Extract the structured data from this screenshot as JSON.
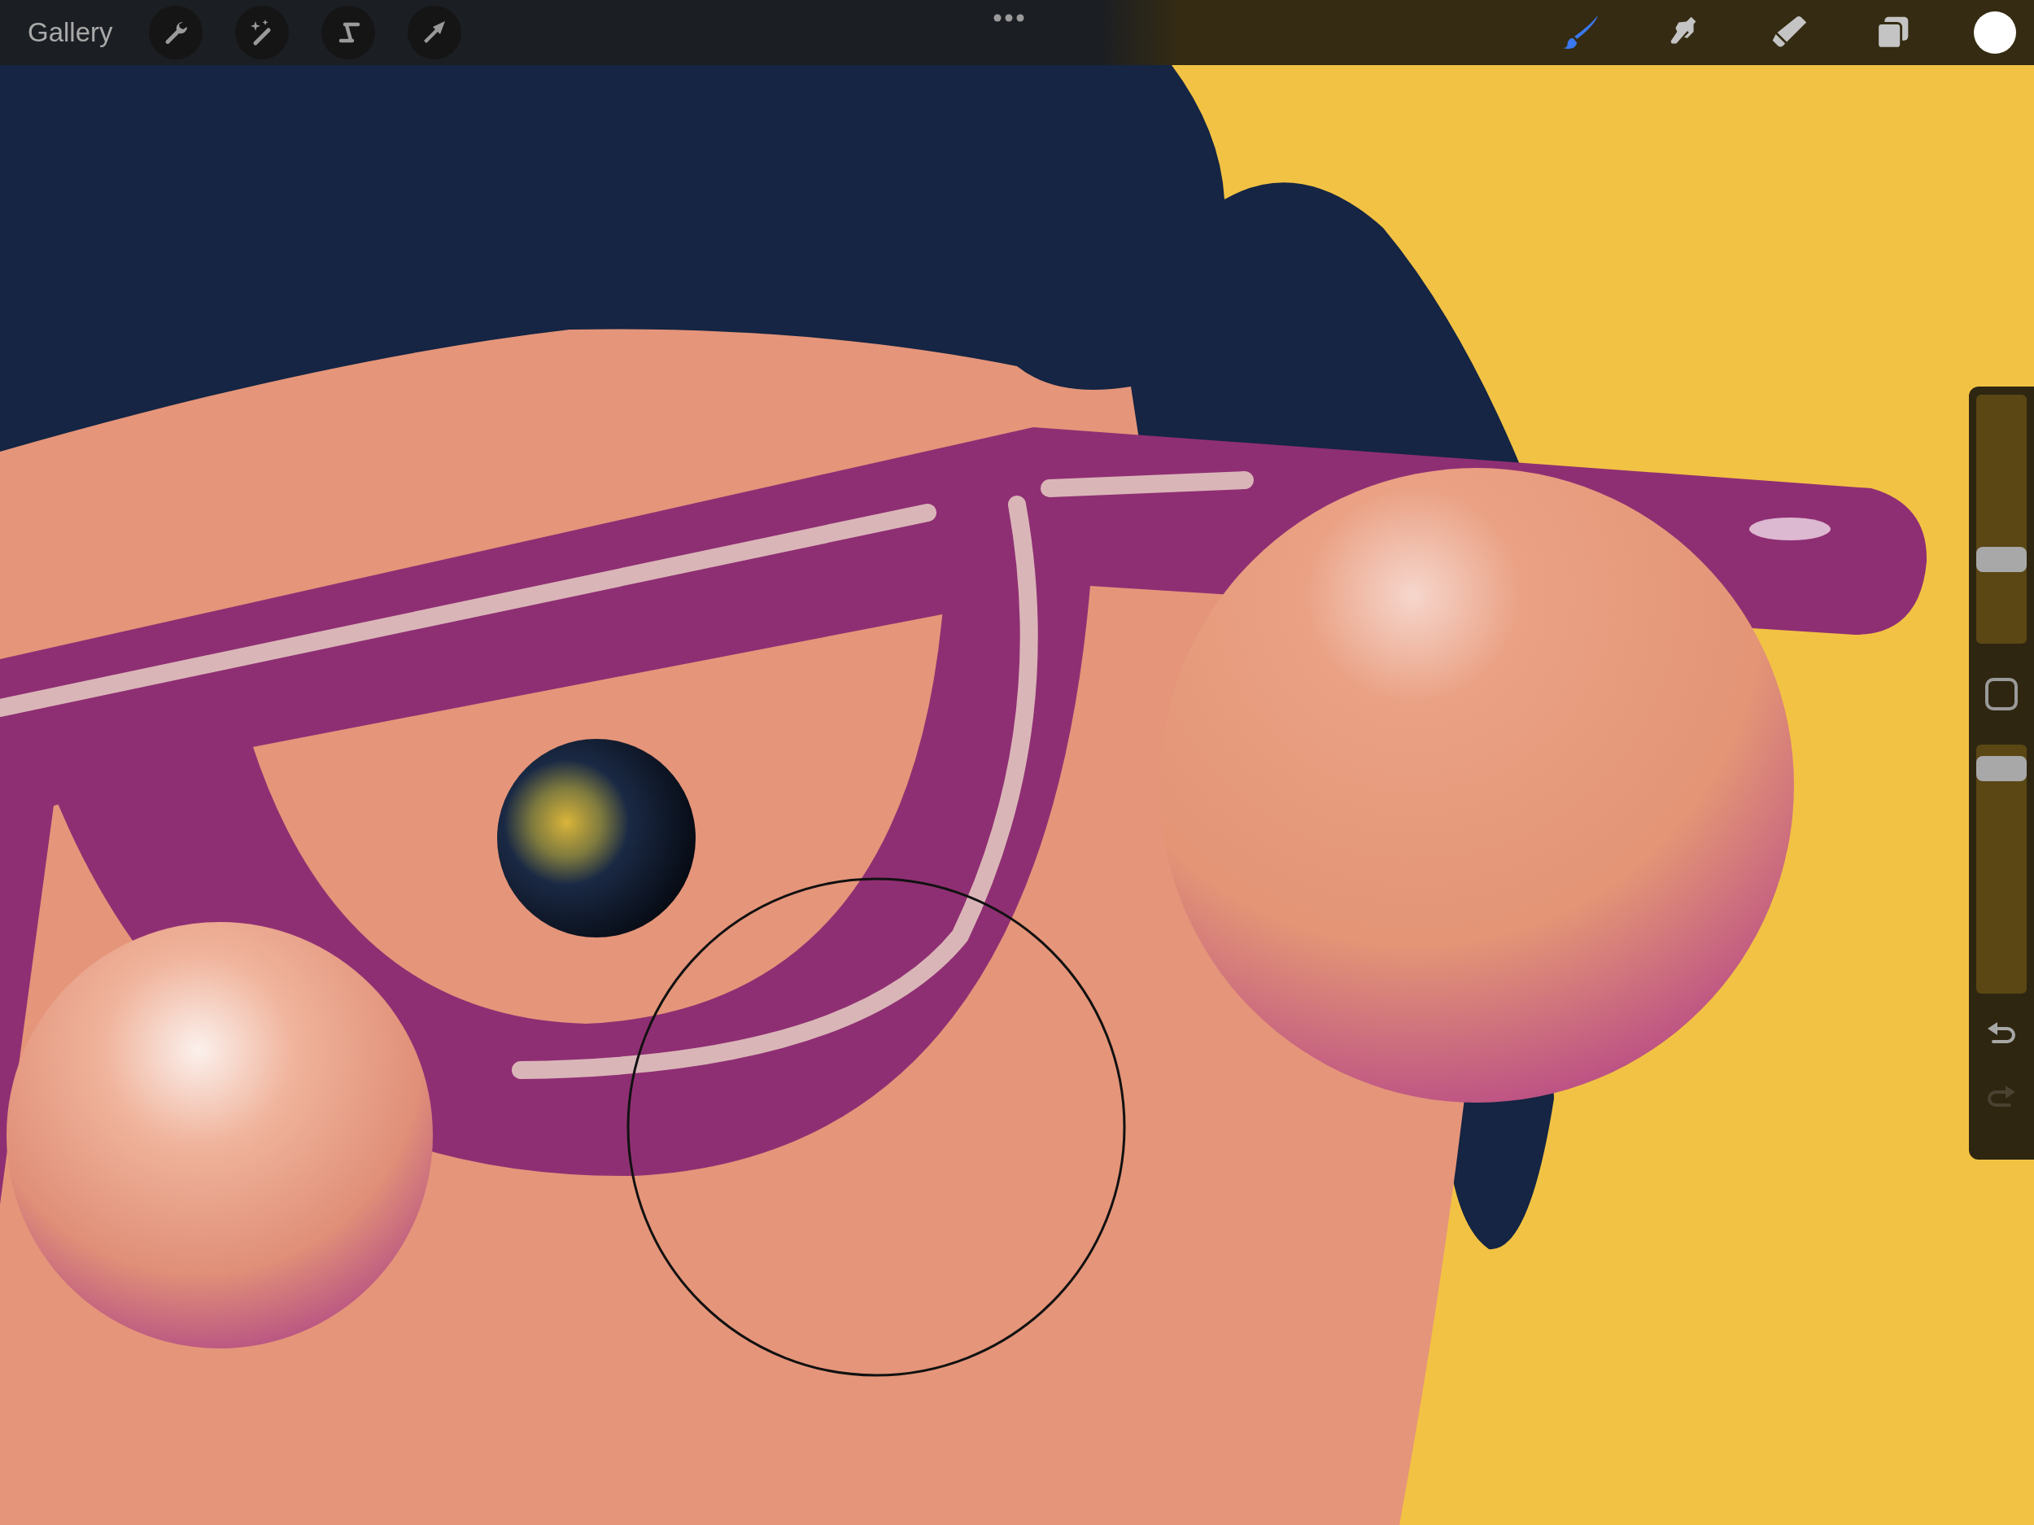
{
  "toolbar": {
    "gallery": "Gallery",
    "left_tools": [
      {
        "kind": "wrench",
        "selected": false
      },
      {
        "kind": "wand",
        "selected": false
      },
      {
        "kind": "selection",
        "selected": false
      },
      {
        "kind": "arrow",
        "selected": false
      }
    ],
    "right_tools": [
      {
        "kind": "brush",
        "selected": true
      },
      {
        "kind": "smudge",
        "selected": false
      },
      {
        "kind": "eraser",
        "selected": false
      },
      {
        "kind": "layers",
        "selected": false
      }
    ]
  },
  "sidebar": {
    "size_slider": {
      "level": 0.32
    },
    "opacity_slider": {
      "level": 0.95
    },
    "undo": {
      "disabled": false
    },
    "redo": {
      "disabled": true
    }
  }
}
